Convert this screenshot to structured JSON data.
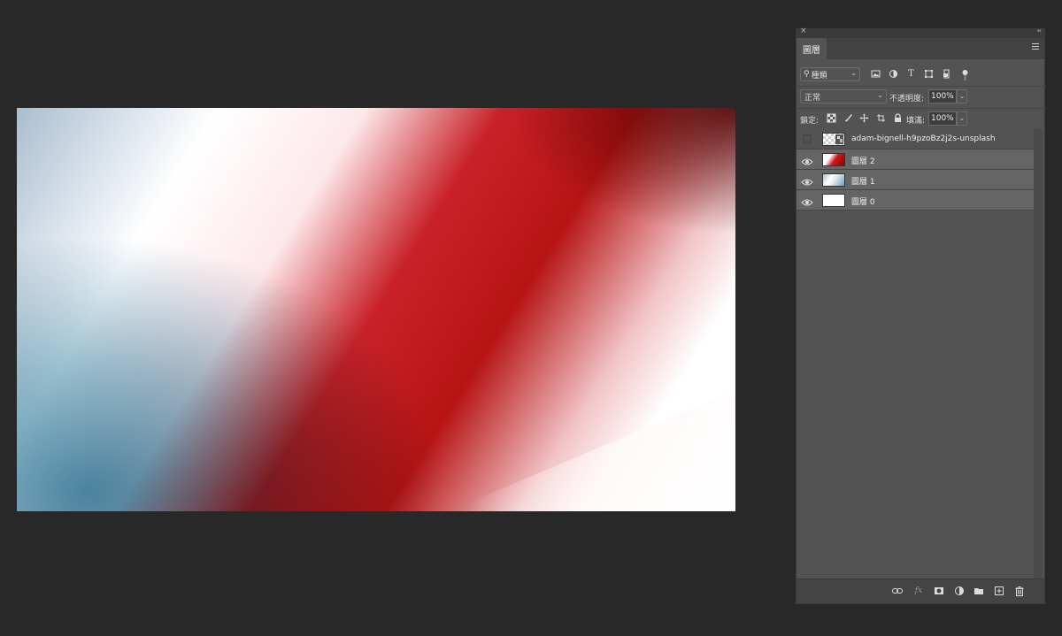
{
  "panel": {
    "tab_label": "圖層",
    "close_glyph": "×",
    "collapse_glyph": "‹‹",
    "filter": {
      "kind_label": "種類",
      "icons": [
        "image-filter-icon",
        "adjustment-filter-icon",
        "type-filter-icon",
        "shape-filter-icon",
        "smart-object-filter-icon",
        "filter-toggle-icon"
      ]
    },
    "blend_mode": "正常",
    "opacity_label": "不透明度:",
    "opacity_value": "100%",
    "lock_label": "鎖定:",
    "fill_label": "填滿:",
    "fill_value": "100%",
    "layers": [
      {
        "name": "adam-bignell-h9pzoBz2j2s-unsplash",
        "visible": false
      },
      {
        "name": "圖層 2",
        "visible": true
      },
      {
        "name": "圖層 1",
        "visible": true
      },
      {
        "name": "圖層 0",
        "visible": true
      }
    ]
  },
  "colors": {
    "app_background": "#282828",
    "panel_background": "#535353",
    "gradient_red": "#b71414",
    "gradient_blue": "#4a8ca8"
  }
}
